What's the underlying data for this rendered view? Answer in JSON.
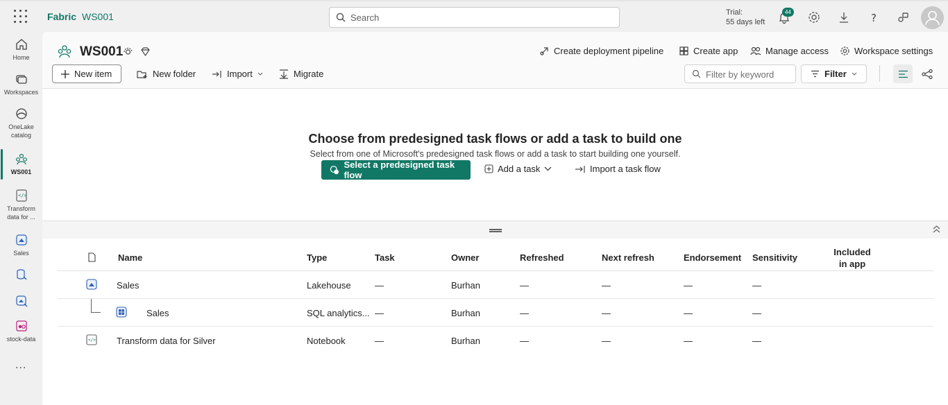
{
  "topbar": {
    "brand": "Fabric",
    "workspace": "WS001",
    "search_placeholder": "Search",
    "trial_line1": "Trial:",
    "trial_line2": "55 days left",
    "notification_count": "44"
  },
  "leftnav": {
    "items": [
      {
        "label": "Home"
      },
      {
        "label": "Workspaces"
      },
      {
        "label": "OneLake catalog"
      },
      {
        "label": "WS001"
      },
      {
        "label": "Transform data for ..."
      },
      {
        "label": "Sales"
      },
      {
        "label": "stock-data"
      }
    ],
    "more": "..."
  },
  "header": {
    "title": "WS001",
    "actions": [
      {
        "label": "Create deployment pipeline"
      },
      {
        "label": "Create app"
      },
      {
        "label": "Manage access"
      },
      {
        "label": "Workspace settings"
      }
    ],
    "toolbar": {
      "new_item": "New item",
      "new_folder": "New folder",
      "import": "Import",
      "migrate": "Migrate",
      "filter_placeholder": "Filter by keyword",
      "filter": "Filter"
    }
  },
  "taskflow": {
    "title": "Choose from predesigned task flows or add a task to build one",
    "subtitle": "Select from one of Microsoft's predesigned task flows or add a task to start building one yourself.",
    "primary": "Select a predesigned task flow",
    "add_task": "Add a task",
    "import_flow": "Import a task flow"
  },
  "table": {
    "columns": {
      "name": "Name",
      "type": "Type",
      "task": "Task",
      "owner": "Owner",
      "refreshed": "Refreshed",
      "next_refresh": "Next refresh",
      "endorsement": "Endorsement",
      "sensitivity": "Sensitivity",
      "included_line1": "Included",
      "included_line2": "in app"
    },
    "rows": [
      {
        "name": "Sales",
        "type": "Lakehouse",
        "task": "—",
        "owner": "Burhan",
        "refreshed": "—",
        "next_refresh": "—",
        "endorsement": "—",
        "sensitivity": "—"
      },
      {
        "name": "Sales",
        "type": "SQL analytics...",
        "task": "—",
        "owner": "Burhan",
        "refreshed": "—",
        "next_refresh": "—",
        "endorsement": "—",
        "sensitivity": "—"
      },
      {
        "name": "Transform data for Silver",
        "type": "Notebook",
        "task": "—",
        "owner": "Burhan",
        "refreshed": "—",
        "next_refresh": "—",
        "endorsement": "—",
        "sensitivity": "—"
      }
    ]
  },
  "colors": {
    "accent": "#117865"
  }
}
